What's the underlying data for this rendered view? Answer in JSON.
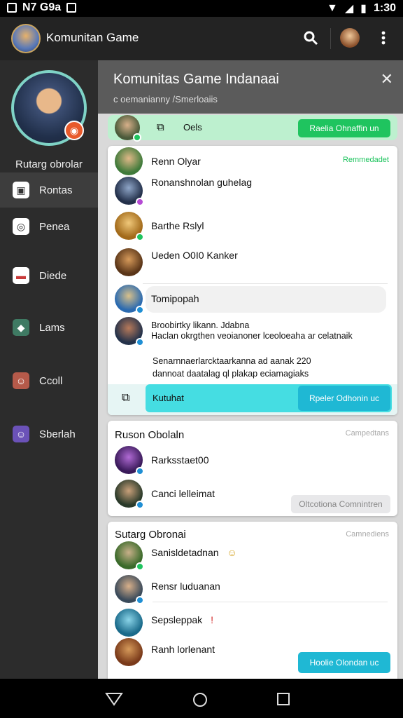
{
  "status": {
    "time_left": "N7 G9a",
    "time": "1:30"
  },
  "appbar": {
    "title": "Komunitan Game",
    "search_icon": "search-icon",
    "more_icon": "more-vert-icon"
  },
  "drawer": {
    "profile_name": "Rutarg obrolar",
    "items": [
      {
        "label": "Rontas",
        "icon": "photo-icon",
        "color": "#4a4a4a"
      },
      {
        "label": "Penea",
        "icon": "camera-icon",
        "color": "#4a4a4a"
      },
      {
        "label": "Diede",
        "icon": "folder-icon",
        "color": "#c93a3a"
      },
      {
        "label": "Lams",
        "icon": "game-icon",
        "color": "#3f7a63"
      },
      {
        "label": "Ccoll",
        "icon": "avatar-icon",
        "color": "#b55a4a"
      },
      {
        "label": "Sberlah",
        "icon": "avatar-icon",
        "color": "#6b52b8"
      }
    ]
  },
  "sheet": {
    "title": "Komunitas Game Indanaai",
    "subtitle": "c oemanianny /Smerloaiis",
    "green_row": {
      "label": "Oels",
      "button": "Raelia Ohnaffin un"
    },
    "card1": {
      "tag": "Remmedadet",
      "rows": [
        {
          "name": "Renn Olyar"
        },
        {
          "name": "Ronanshnolan guhelag"
        },
        {
          "name": "Barthe Rslyl"
        },
        {
          "name": "Ueden O0I0 Kanker"
        },
        {
          "name": "Tomipopah"
        },
        {
          "name": "Broobirtky likann. Jdabna"
        },
        {
          "name": "Haclan okrgthen veoianoner lceoloeaha ar celatnaik"
        },
        {
          "name": "Senarnnaerlarcktaarkanna ad aanak 220"
        },
        {
          "name": "dannoat daatalag ql plakap eciamagiaks"
        }
      ],
      "bottom_label": "Kutuhat",
      "bottom_button": "Rpeler Odhonin uc"
    },
    "card2": {
      "title": "Ruson Obolaln",
      "tag": "Campedtans",
      "rows": [
        {
          "name": "Rarksstaet00"
        },
        {
          "name": "Canci lelleimat"
        }
      ],
      "button": "Oltcotiona Comnintren"
    },
    "card3": {
      "title": "Sutarg Obronai",
      "tag": "Camnediens",
      "rows": [
        {
          "name": "Sanisldetadnan"
        },
        {
          "name": "Rensr luduanan"
        },
        {
          "name": "Sepsleppak"
        },
        {
          "name": "Ranh lorlenant"
        }
      ],
      "button": "Hoolie Olondan uc"
    }
  },
  "colors": {
    "accent_green": "#1fc45f",
    "accent_cyan": "#1fb8d4",
    "green_row_bg": "#bdf0cf",
    "cyan_row_bg": "#45dde2"
  }
}
